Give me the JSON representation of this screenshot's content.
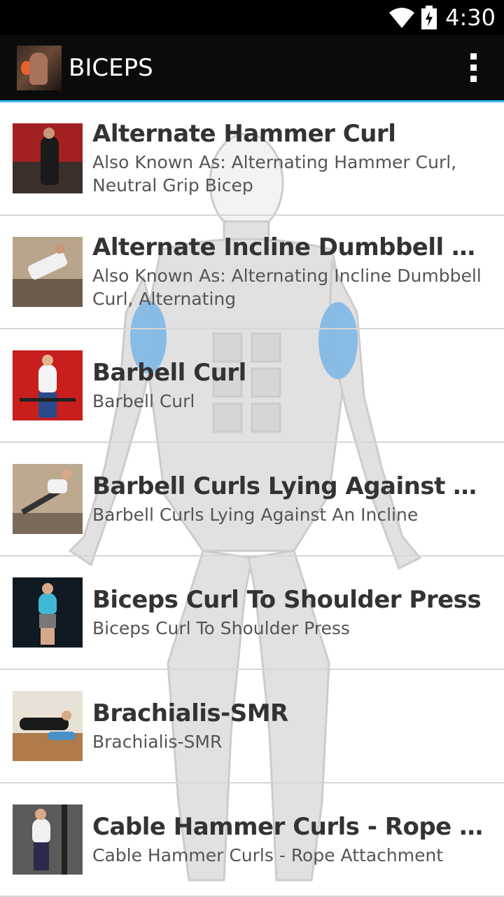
{
  "status_bar": {
    "time": "4:30"
  },
  "action_bar": {
    "title": "BICEPS"
  },
  "exercises": [
    {
      "name": "Alternate Hammer Curl",
      "aka": "Also Known As: Alternating Hammer Curl, Neutral Grip Bicep"
    },
    {
      "name": "Alternate Incline Dumbbell Curl",
      "aka": "Also Known As: Alternating Incline Dumbbell Curl, Alternating"
    },
    {
      "name": "Barbell Curl",
      "aka": "Barbell Curl"
    },
    {
      "name": "Barbell Curls Lying Against An In...",
      "aka": "Barbell Curls Lying Against An Incline"
    },
    {
      "name": "Biceps Curl To Shoulder Press",
      "aka": "Biceps Curl To Shoulder Press"
    },
    {
      "name": "Brachialis-SMR",
      "aka": "Brachialis-SMR"
    },
    {
      "name": "Cable Hammer Curls - Rope Attac...",
      "aka": "Cable Hammer Curls - Rope Attachment"
    }
  ],
  "colors": {
    "accent": "#33b5e5",
    "biceps_highlight": "#7fb8e6"
  }
}
